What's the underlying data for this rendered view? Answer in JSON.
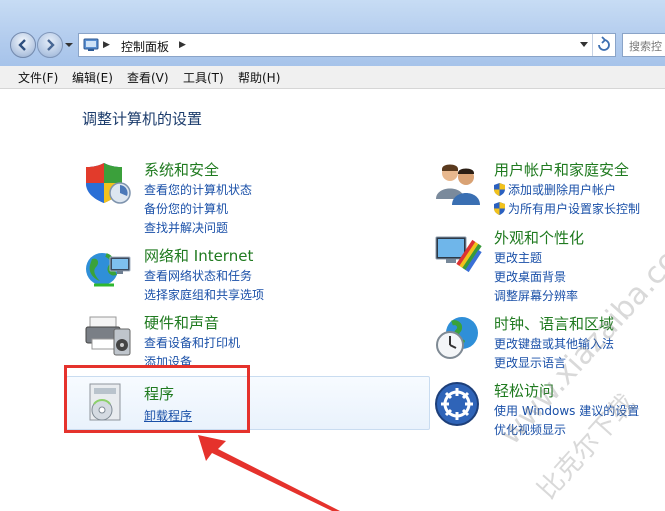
{
  "address": {
    "path": "控制面板",
    "search_placeholder": "搜索控"
  },
  "menu": [
    "文件(F)",
    "编辑(E)",
    "查看(V)",
    "工具(T)",
    "帮助(H)"
  ],
  "page_title": "调整计算机的设置",
  "categories": {
    "system_security": {
      "title": "系统和安全",
      "links": [
        "查看您的计算机状态",
        "备份您的计算机",
        "查找并解决问题"
      ]
    },
    "network": {
      "title": "网络和 Internet",
      "links": [
        "查看网络状态和任务",
        "选择家庭组和共享选项"
      ]
    },
    "hardware": {
      "title": "硬件和声音",
      "links": [
        "查看设备和打印机",
        "添加设备"
      ]
    },
    "programs": {
      "title": "程序",
      "links": [
        "卸载程序"
      ]
    },
    "user_accounts": {
      "title": "用户帐户和家庭安全",
      "links": [
        "添加或删除用户帐户",
        "为所有用户设置家长控制"
      ]
    },
    "appearance": {
      "title": "外观和个性化",
      "links": [
        "更改主题",
        "更改桌面背景",
        "调整屏幕分辨率"
      ]
    },
    "clock": {
      "title": "时钟、语言和区域",
      "links": [
        "更改键盘或其他输入法",
        "更改显示语言"
      ]
    },
    "ease": {
      "title": "轻松访问",
      "links": [
        "使用 Windows 建议的设置",
        "优化视频显示"
      ]
    }
  },
  "watermark": {
    "line1": "www.xiazaiba.com",
    "line2": "比克尔下载"
  },
  "colors": {
    "category_green": "#1f7a1f",
    "link_blue": "#1a50a8",
    "annotation_red": "#e5322c"
  }
}
